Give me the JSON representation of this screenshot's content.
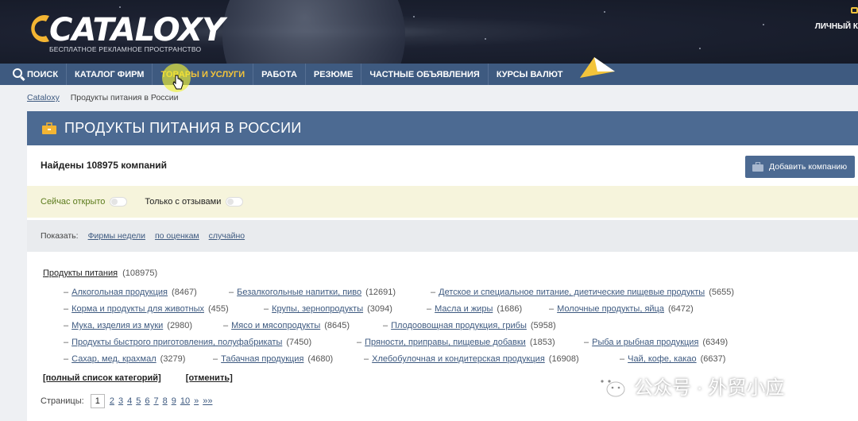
{
  "header": {
    "logo_text": "CATALOXY",
    "tagline": "БЕСПЛАТНОЕ РЕКЛАМНОЕ ПРОСТРАНСТВО",
    "account_label": "ЛИЧНЫЙ К"
  },
  "nav": {
    "items": [
      {
        "label": "ПОИСК"
      },
      {
        "label": "КАТАЛОГ ФИРМ"
      },
      {
        "label": "ТОВАРЫ И УСЛУГИ"
      },
      {
        "label": "РАБОТА"
      },
      {
        "label": "РЕЗЮМЕ"
      },
      {
        "label": "ЧАСТНЫЕ ОБЪЯВЛЕНИЯ"
      },
      {
        "label": "КУРСЫ ВАЛЮТ"
      }
    ],
    "active_color": "#f3c43b"
  },
  "breadcrumb": {
    "home": "Cataloxy",
    "current": "Продукты питания в России"
  },
  "page": {
    "title": "ПРОДУКТЫ ПИТАНИЯ В РОССИИ",
    "found": "Найдены 108975 компаний",
    "add_company": "Добавить компанию"
  },
  "filters": {
    "open_now": "Сейчас открыто",
    "with_reviews": "Только с отзывами"
  },
  "show": {
    "label": "Показать:",
    "options": [
      "Фирмы недели",
      "по оценкам",
      "случайно"
    ]
  },
  "categories": {
    "root": {
      "name": "Продукты питания",
      "count": "(108975)"
    },
    "rows": [
      [
        {
          "name": "Алкогольная продукция",
          "count": "(8467)"
        },
        {
          "name": "Безалкогольные напитки, пиво",
          "count": "(12691)"
        },
        {
          "name": "Детское и специальное питание, диетические пищевые продукты",
          "count": "(5655)"
        }
      ],
      [
        {
          "name": "Корма и продукты для животных",
          "count": "(455)"
        },
        {
          "name": "Крупы, зернопродукты",
          "count": "(3094)"
        },
        {
          "name": "Масла и жиры",
          "count": "(1686)"
        },
        {
          "name": "Молочные продукты, яйца",
          "count": "(6472)"
        }
      ],
      [
        {
          "name": "Мука, изделия из муки",
          "count": "(2980)"
        },
        {
          "name": "Мясо и мясопродукты",
          "count": "(8645)"
        },
        {
          "name": "Плодоовощная продукция, грибы",
          "count": "(5958)"
        }
      ],
      [
        {
          "name": "Продукты быстрого приготовления, полуфабрикаты",
          "count": "(7450)"
        },
        {
          "name": "Пряности, приправы, пищевые добавки",
          "count": "(1853)"
        },
        {
          "name": "Рыба и рыбная продукция",
          "count": "(6349)"
        }
      ],
      [
        {
          "name": "Сахар, мед, крахмал",
          "count": "(3279)"
        },
        {
          "name": "Табачная продукция",
          "count": "(4680)"
        },
        {
          "name": "Хлебобулочная и кондитерская продукция",
          "count": "(16908)"
        },
        {
          "name": "Чай, кофе, какао",
          "count": "(6637)"
        }
      ]
    ],
    "full_list": "[полный список категорий]",
    "cancel": "[отменить]"
  },
  "pagination": {
    "label": "Страницы:",
    "current": "1",
    "pages": [
      "2",
      "3",
      "4",
      "5",
      "6",
      "7",
      "8",
      "9",
      "10",
      "»",
      "»»"
    ]
  },
  "watermark": {
    "text": "公众号 · 外贸小应"
  }
}
